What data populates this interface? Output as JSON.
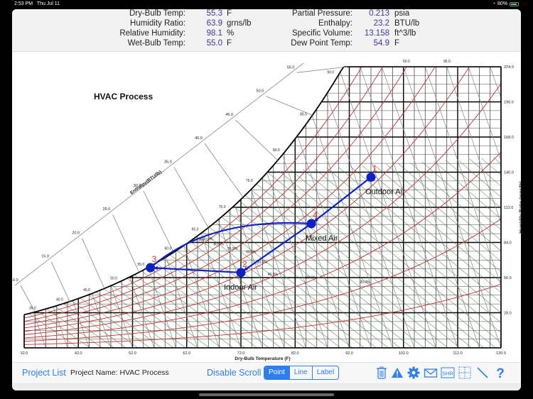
{
  "status_bar": {
    "time": "2:53 PM",
    "date": "Thu Jul 11",
    "battery": "80%"
  },
  "info_panel": {
    "left": [
      {
        "label": "Dry-Bulb Temp:",
        "value": "55.3",
        "unit": "F"
      },
      {
        "label": "Humidity Ratio:",
        "value": "63.9",
        "unit": "grns/lb"
      },
      {
        "label": "Relative Humidity:",
        "value": "98.1",
        "unit": "%"
      },
      {
        "label": "Wet-Bulb Temp:",
        "value": "55.0",
        "unit": "F"
      }
    ],
    "right": [
      {
        "label": "Partial Pressure:",
        "value": "0.213",
        "unit": "psia"
      },
      {
        "label": "Enthalpy:",
        "value": "23.2",
        "unit": "BTU/lb"
      },
      {
        "label": "Specific Volume:",
        "value": "13.158",
        "unit": "ft^3/lb"
      },
      {
        "label": "Dew Point Temp:",
        "value": "54.9",
        "unit": "F"
      }
    ]
  },
  "chart_data": {
    "type": "scatter",
    "title": "HVAC Process",
    "xlabel": "Dry-Bulb Temperature (F)",
    "ylabel": "Humidity Ratio (grns/lb)",
    "enthalpy_label": "Enthalpy(BTU/lb)",
    "xlim": [
      32,
      120
    ],
    "ylim": [
      0,
      224
    ],
    "x_ticks": [
      "32.0",
      "42.0",
      "52.0",
      "62.0",
      "72.0",
      "82.0",
      "92.0",
      "102.0",
      "112.0",
      "120.0"
    ],
    "y_ticks": [
      "28.0",
      "56.0",
      "84.0",
      "112.0",
      "140.0",
      "168.0",
      "196.0",
      "224.0"
    ],
    "enthalpy_ticks": [
      "10.0",
      "15.0",
      "20.0",
      "25.0",
      "30.0",
      "35.0",
      "40.0",
      "45.0",
      "50.0",
      "55.0"
    ],
    "wetbulb_ticks": [
      "35.0",
      "40.0",
      "45.0",
      "50.0",
      "55.0",
      "60.0",
      "65.0",
      "70.0",
      "75.0",
      "80.0",
      "85.0",
      "90.0",
      "95.0",
      "60.0"
    ],
    "rh_labels": [
      "100.0%",
      "90.0%",
      "80.0%",
      "70.0%",
      "60.0%",
      "50.0%",
      "40.0%",
      "30.0%",
      "20.0%",
      "10.0%"
    ],
    "grid": true,
    "points": [
      {
        "id": "1",
        "label": "Outdoor Air",
        "x": 96.0,
        "y": 136.0
      },
      {
        "id": "2",
        "label": "Indoor Air",
        "x": 72.0,
        "y": 60.0
      },
      {
        "id": "3",
        "label": "",
        "x": 55.3,
        "y": 63.9
      },
      {
        "id": "4",
        "label": "Mixed Air",
        "x": 85.0,
        "y": 99.0
      }
    ],
    "process_lines": [
      {
        "from": "1",
        "to": "4"
      },
      {
        "from": "4",
        "to": "2"
      },
      {
        "from": "2",
        "to": "3"
      },
      {
        "from": "3",
        "to": "4"
      }
    ],
    "colors": {
      "process": "#1020c8",
      "rh_lines": "#c83030",
      "wetbulb_lines": "#3a8a3a",
      "label_id": "#e03030"
    }
  },
  "toolbar": {
    "project_list": "Project List",
    "project_name": "Project Name: HVAC Process",
    "disable_scroll": "Disable Scroll",
    "modes": [
      {
        "label": "Point",
        "active": true
      },
      {
        "label": "Line",
        "active": false
      },
      {
        "label": "Label",
        "active": false
      }
    ],
    "shr_label": "SHR",
    "help_label": "?",
    "icons": [
      "trash-icon",
      "warning-icon",
      "gear-icon",
      "mail-icon",
      "shr-icon",
      "grid-toggle-icon",
      "line-tool-icon",
      "help-icon"
    ]
  }
}
